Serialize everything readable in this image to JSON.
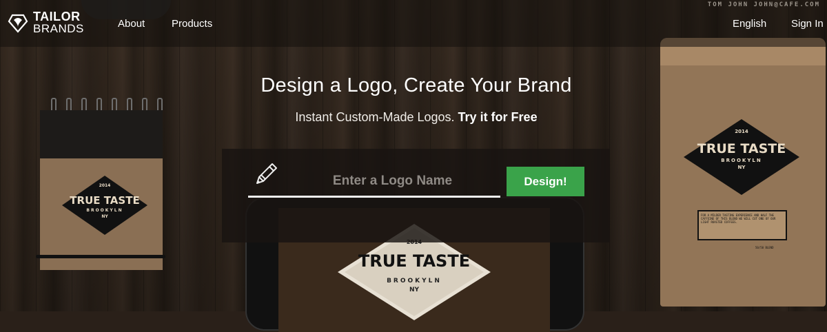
{
  "brand": {
    "line1": "TAILOR",
    "line2": "BRANDS"
  },
  "nav": {
    "about": "About",
    "products": "Products",
    "language": "English",
    "sign_in": "Sign In"
  },
  "background_text": {
    "top_email": "TOM JOHN JOHN@CAFE.COM",
    "notebook_logo": "TRUE TASTE",
    "notebook_sub": "BROOKYLN",
    "notebook_year": "2014",
    "notebook_ny": "NY",
    "bag_logo": "TRUE TASTE",
    "bag_sub": "BROOKYLN",
    "bag_ny": "NY",
    "bag_year": "2014",
    "bag_label": "FOR A MILDER TASTING EXPERIENCE AND HALF THE CAFFEINE OF THIS BLEND WE WILL CUT ONE OF OUR LIGHT ROASTED COFFEES.",
    "bag_blend": "50/50 BLEND",
    "tablet_logo": "TRUE TASTE",
    "tablet_sub": "BROOKYLN",
    "tablet_ny": "NY",
    "tablet_year": "2014"
  },
  "hero": {
    "title": "Design a Logo, Create Your Brand",
    "subtitle_plain": "Instant Custom-Made Logos.",
    "subtitle_bold": "Try it for Free"
  },
  "form": {
    "placeholder": "Enter a Logo Name",
    "value": "",
    "button_label": "Design!"
  },
  "colors": {
    "button": "#3aa34a",
    "header_overlay": "rgba(20,16,13,0.55)"
  },
  "icons": {
    "logo": "heart-shield-icon",
    "input": "pencil-icon"
  }
}
